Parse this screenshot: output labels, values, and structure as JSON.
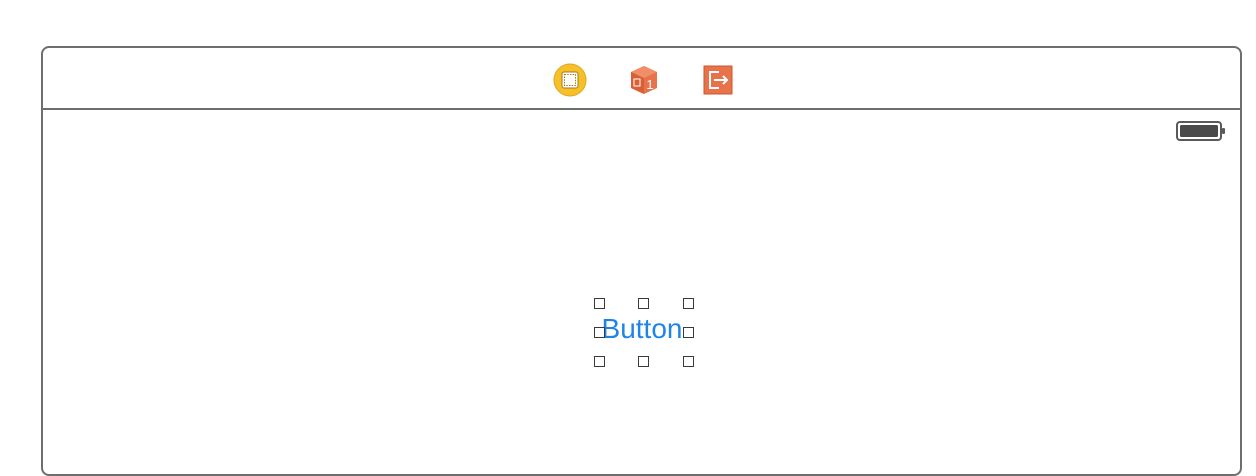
{
  "scene": {
    "dock": {
      "items": [
        {
          "icon": "view-controller-icon",
          "color": "#f7c02b"
        },
        {
          "icon": "first-responder-icon",
          "color": "#e8734a"
        },
        {
          "icon": "exit-icon",
          "color": "#e8734a"
        }
      ]
    },
    "view": {
      "status_bar": {
        "icon": "battery-icon"
      },
      "button": {
        "label": "Button",
        "color": "#1f84e8",
        "selected": true
      }
    }
  }
}
